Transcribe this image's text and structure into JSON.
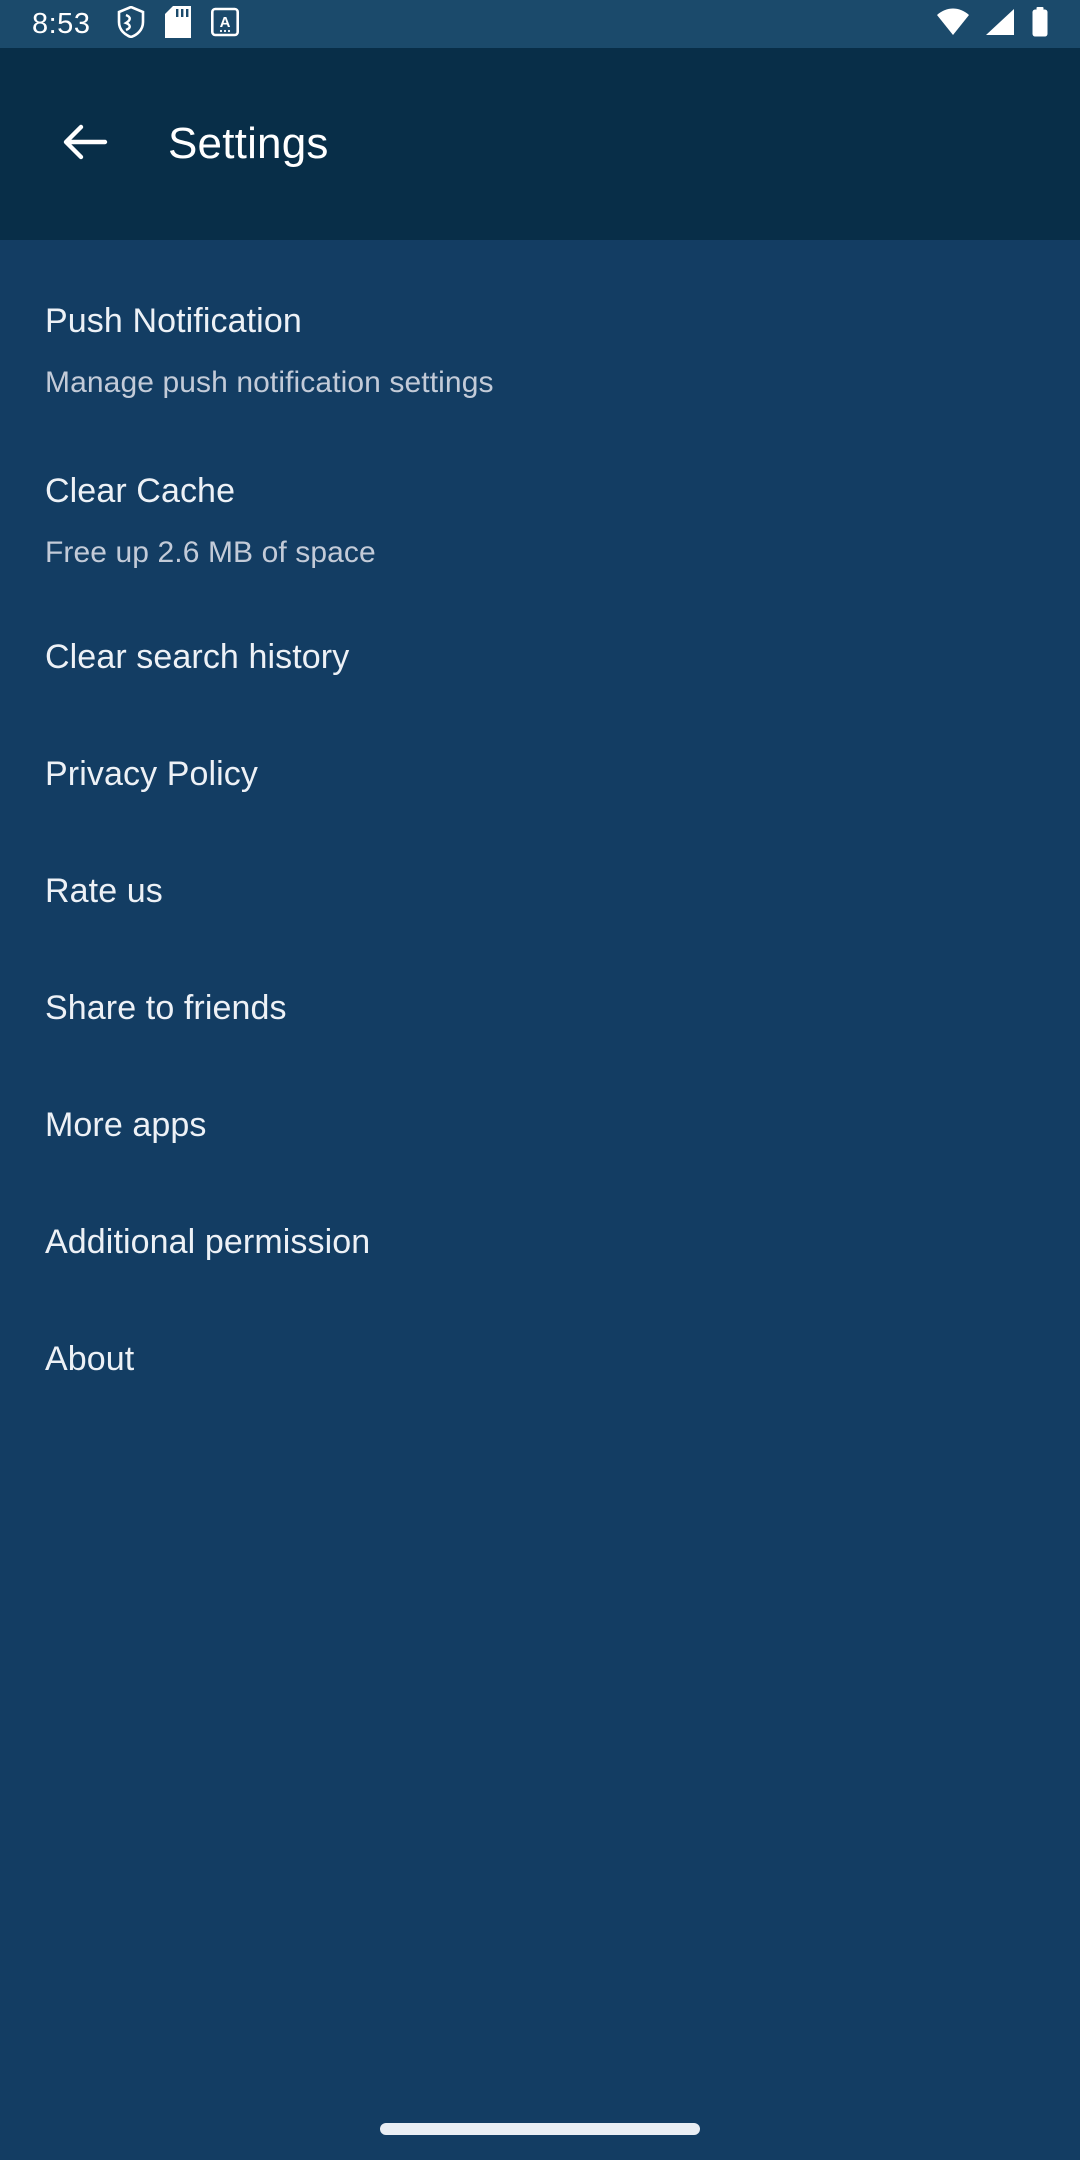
{
  "status_bar": {
    "time": "8:53",
    "left_icons": [
      "shield-icon",
      "sd-card-icon",
      "keyboard-language-icon"
    ],
    "right_icons": [
      "wifi-icon",
      "cellular-signal-icon",
      "battery-icon"
    ],
    "background_color": "#1b4a6b"
  },
  "app_bar": {
    "back_icon": "back-arrow-icon",
    "title": "Settings",
    "background_color": "#082e48",
    "title_color": "#ffffff"
  },
  "theme": {
    "body_background": "#133d63",
    "title_color": "#edf1f6",
    "subtitle_color": "#c3cbd8",
    "home_indicator_color": "#e9eef4"
  },
  "settings": {
    "items": [
      {
        "title": "Push Notification",
        "subtitle": "Manage push notification settings"
      },
      {
        "title": "Clear Cache",
        "subtitle": "Free up 2.6 MB of space"
      },
      {
        "title": "Clear search history",
        "subtitle": null
      },
      {
        "title": "Privacy Policy",
        "subtitle": null
      },
      {
        "title": "Rate us",
        "subtitle": null
      },
      {
        "title": "Share to friends",
        "subtitle": null
      },
      {
        "title": "More apps",
        "subtitle": null
      },
      {
        "title": "Additional permission",
        "subtitle": null
      },
      {
        "title": "About",
        "subtitle": null
      }
    ]
  },
  "navigation": {
    "home_indicator": "home-indicator"
  }
}
